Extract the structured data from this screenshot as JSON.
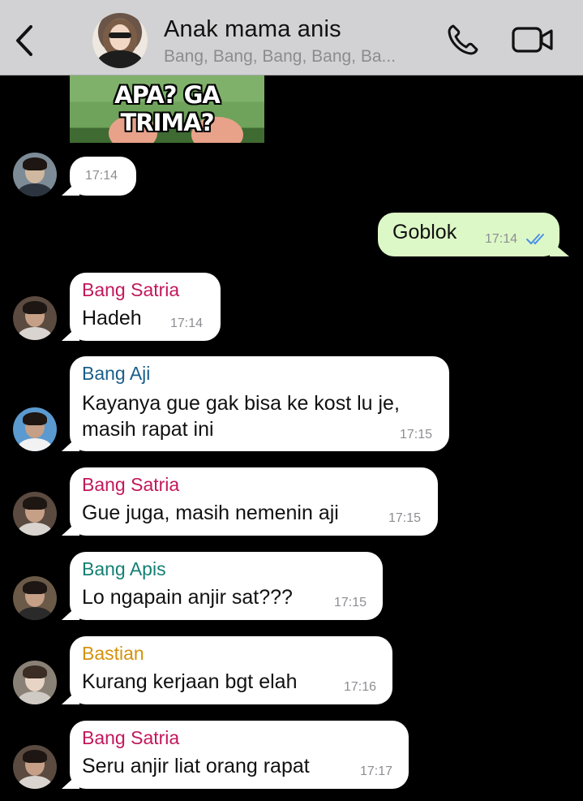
{
  "header": {
    "title": "Anak mama anis",
    "subtitle": "Bang, Bang, Bang, Bang, Ba..."
  },
  "sticker": {
    "caption": "APA? GA TRIMA?"
  },
  "messages": [
    {
      "type": "in",
      "sender": "",
      "text": "",
      "time": "17:14"
    },
    {
      "type": "out",
      "text": "Goblok",
      "time": "17:14",
      "status": "read"
    },
    {
      "type": "in",
      "sender": "Bang Satria",
      "sender_color": "#c2185b",
      "lines": [
        "Hadeh"
      ],
      "time": "17:14"
    },
    {
      "type": "in",
      "sender": "Bang Aji",
      "sender_color": "#1a5f8a",
      "lines": [
        "Kayanya gue gak bisa ke kost lu je,",
        "masih rapat ini"
      ],
      "time": "17:15"
    },
    {
      "type": "in",
      "sender": "Bang Satria",
      "sender_color": "#c2185b",
      "lines": [
        "Gue juga, masih nemenin aji"
      ],
      "time": "17:15"
    },
    {
      "type": "in",
      "sender": "Bang Apis",
      "sender_color": "#137f73",
      "lines": [
        "Lo ngapain anjir sat???"
      ],
      "time": "17:15"
    },
    {
      "type": "in",
      "sender": "Bastian",
      "sender_color": "#d4920a",
      "lines": [
        "Kurang kerjaan bgt elah"
      ],
      "time": "17:16"
    },
    {
      "type": "in",
      "sender": "Bang Satria",
      "sender_color": "#c2185b",
      "lines": [
        "Seru anjir liat orang rapat"
      ],
      "time": "17:17"
    }
  ],
  "colors": {
    "header_bg": "#d2d2d4",
    "outgoing_bubble": "#dcf8c6",
    "incoming_bubble": "#ffffff",
    "chat_bg": "#000000",
    "read_tick": "#4a8fe7"
  }
}
